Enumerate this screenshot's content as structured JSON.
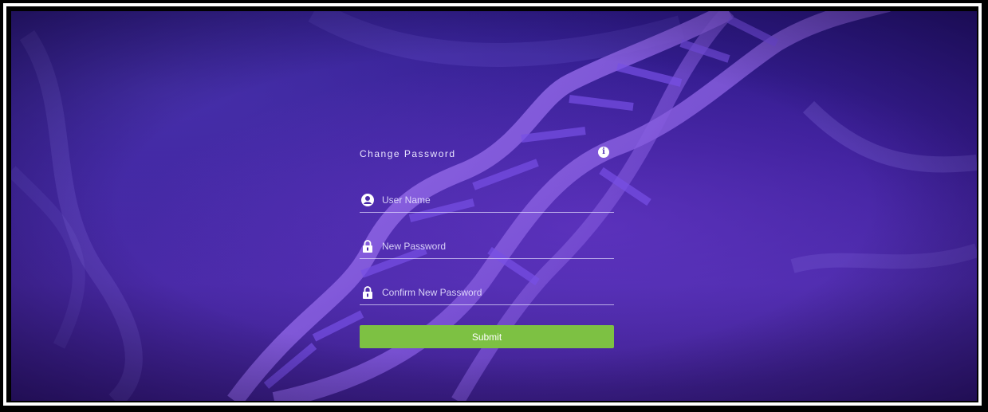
{
  "form": {
    "title": "Change Password",
    "info_icon": "info-icon",
    "fields": [
      {
        "icon": "user-icon",
        "placeholder": "User Name",
        "value": ""
      },
      {
        "icon": "lock-icon",
        "placeholder": "New Password",
        "value": ""
      },
      {
        "icon": "lock-icon",
        "placeholder": "Confirm New Password",
        "value": ""
      }
    ],
    "submit_label": "Submit"
  },
  "colors": {
    "background": "#3a1e96",
    "submit": "#7dc143",
    "text": "#e9e4ff"
  }
}
